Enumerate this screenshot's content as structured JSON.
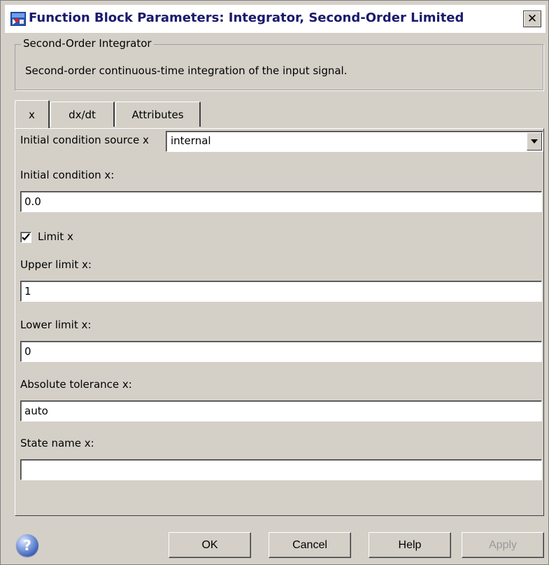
{
  "window": {
    "title": "Function Block Parameters: Integrator, Second-Order Limited",
    "close_label": "✕"
  },
  "group": {
    "legend": "Second-Order Integrator",
    "description": "Second-order continuous-time integration of the input signal."
  },
  "tabs": [
    {
      "label": "x",
      "active": true
    },
    {
      "label": "dx/dt",
      "active": false
    },
    {
      "label": "Attributes",
      "active": false
    }
  ],
  "form": {
    "ic_source_label": "Initial condition source x",
    "ic_source_value": "internal",
    "ic_label": "Initial condition x:",
    "ic_value": "0.0",
    "limit_label": "Limit x",
    "limit_checked": true,
    "upper_label": "Upper limit x:",
    "upper_value": "1",
    "lower_label": "Lower limit x:",
    "lower_value": "0",
    "abstol_label": "Absolute tolerance x:",
    "abstol_value": "auto",
    "state_label": "State name x:",
    "state_value": ""
  },
  "buttons": {
    "ok": "OK",
    "cancel": "Cancel",
    "help": "Help",
    "apply": "Apply",
    "help_icon": "?"
  },
  "colors": {
    "dialog_bg": "#d4d0c8",
    "title_text": "#1a1a6e",
    "disabled_text": "#9a9a9a"
  }
}
